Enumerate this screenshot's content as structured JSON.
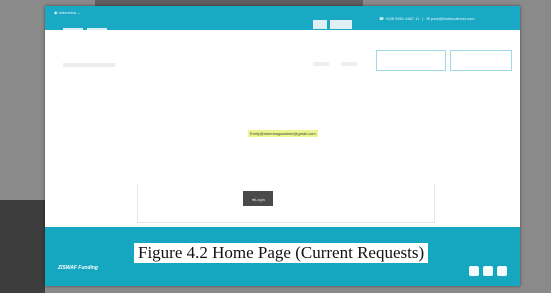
{
  "topbar": {
    "region": "◉ Indonesia ⌄",
    "phone": "☎ +628 5951 4567 11",
    "email": "✉ pwd@lklsklocalhost.com"
  },
  "main": {
    "user_email": "Emily@mlembagaadmin@gmail.com",
    "login_button": "◄Login"
  },
  "footer": {
    "brand": "ZISWAF Funding"
  },
  "caption": "Figure 4.2 Home Page (Current Requests)",
  "colors": {
    "topbar": "#1aa9c4",
    "footer": "#16a7c0",
    "highlight": "#eaf58e",
    "login_button": "#4a4a4a"
  }
}
